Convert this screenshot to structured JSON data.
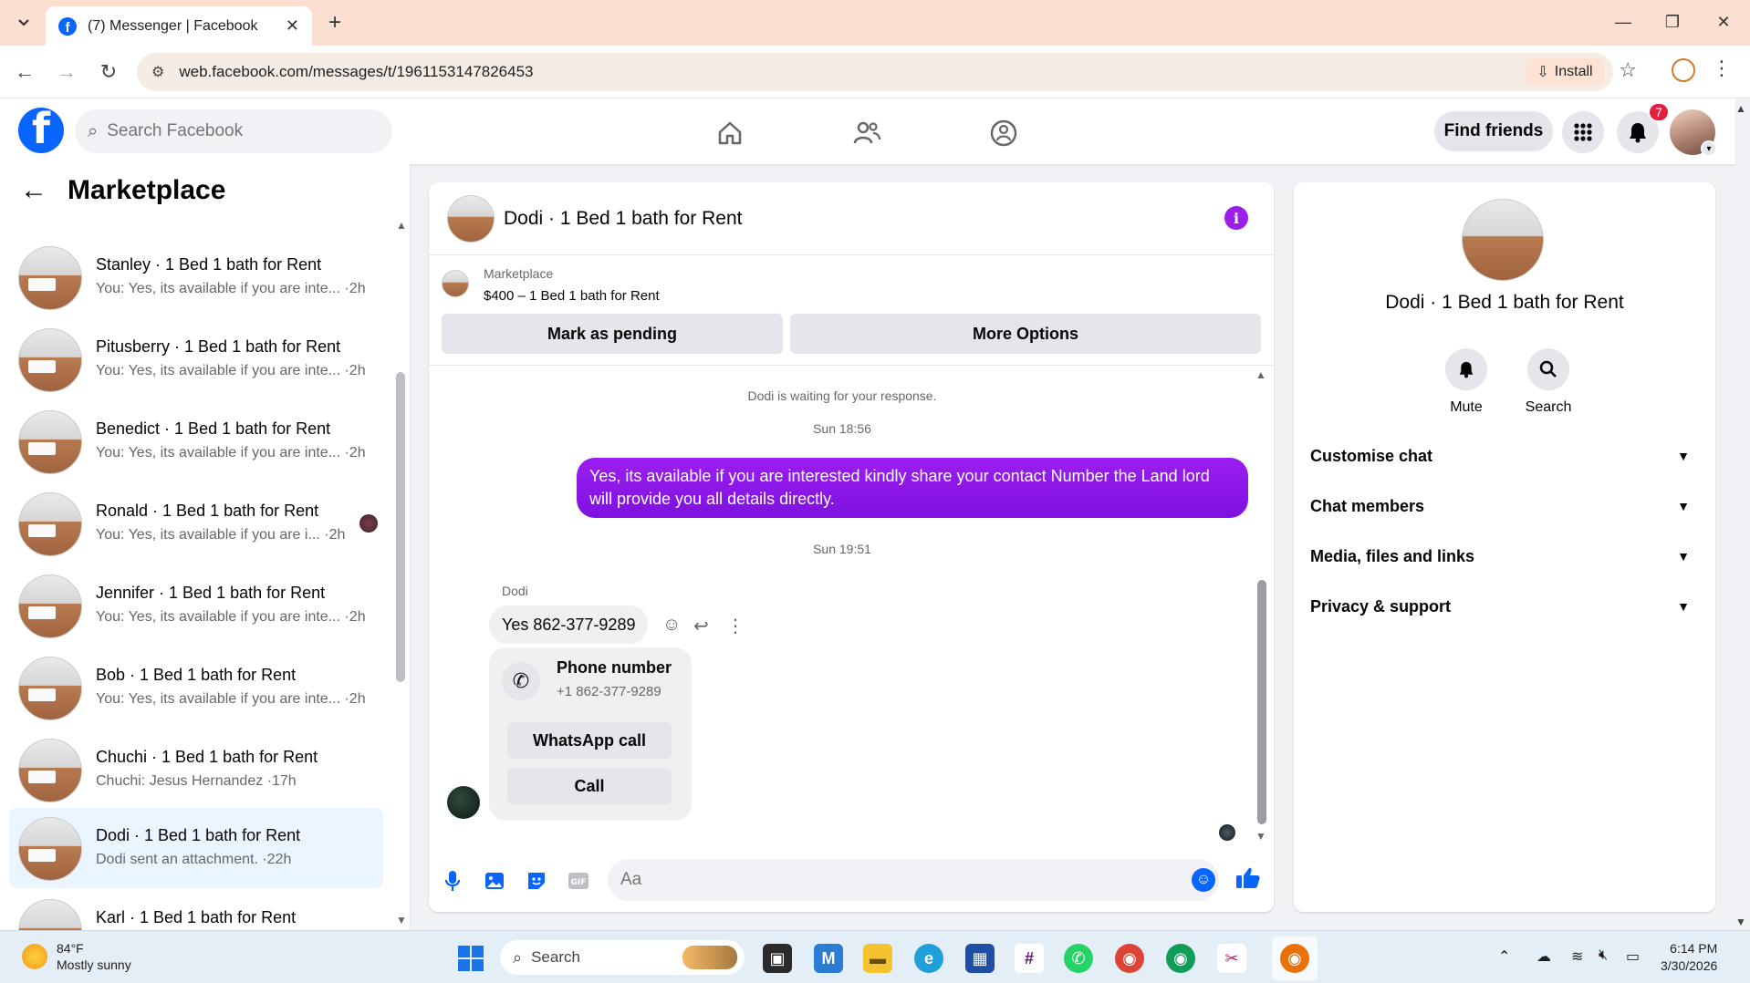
{
  "browser": {
    "tab_title": "(7) Messenger | Facebook",
    "url": "web.facebook.com/messages/t/1961153147826453",
    "install_label": "Install"
  },
  "header": {
    "search_placeholder": "Search Facebook",
    "find_friends_label": "Find friends",
    "notification_count": "7"
  },
  "sidebar": {
    "title": "Marketplace",
    "conversations": [
      {
        "name": "Stanley · 1 Bed 1 bath for Rent",
        "snippet": "You: Yes, its available if you are inte... ·2h"
      },
      {
        "name": "Pitusberry · 1 Bed 1 bath for Rent",
        "snippet": "You: Yes, its available if you are inte... ·2h"
      },
      {
        "name": "Benedict · 1 Bed 1 bath for Rent",
        "snippet": "You: Yes, its available if you are inte... ·2h"
      },
      {
        "name": "Ronald · 1 Bed 1 bath for Rent",
        "snippet": "You: Yes, its available if you are i... ·2h"
      },
      {
        "name": "Jennifer · 1 Bed 1 bath for Rent",
        "snippet": "You: Yes, its available if you are inte... ·2h"
      },
      {
        "name": "Bob · 1 Bed 1 bath for Rent",
        "snippet": "You: Yes, its available if you are inte... ·2h"
      },
      {
        "name": "Chuchi · 1 Bed 1 bath for Rent",
        "snippet": "Chuchi: Jesus Hernandez ·17h"
      },
      {
        "name": "Dodi · 1 Bed 1 bath for Rent",
        "snippet": "Dodi sent an attachment. ·22h"
      },
      {
        "name": "Karl · 1 Bed 1 bath for Rent",
        "snippet": ""
      }
    ]
  },
  "chat": {
    "title": "Dodi · 1 Bed 1 bath for Rent",
    "marketplace_label": "Marketplace",
    "listing": "$400 – 1 Bed 1 bath for Rent",
    "mark_pending_label": "Mark as pending",
    "more_options_label": "More Options",
    "waiting_notice": "Dodi is waiting for your response.",
    "time_1": "Sun 18:56",
    "outgoing_message": "Yes, its available if you are interested kindly share your contact Number the Land lord will provide you all details directly.",
    "time_2": "Sun 19:51",
    "sender_name": "Dodi",
    "incoming_message": "Yes 862-377-9289",
    "phone_card": {
      "title": "Phone number",
      "number": "+1 862-377-9289",
      "whatsapp_label": "WhatsApp call",
      "call_label": "Call"
    },
    "composer_placeholder": "Aa"
  },
  "info_panel": {
    "name": "Dodi · 1 Bed 1 bath for Rent",
    "mute_label": "Mute",
    "search_label": "Search",
    "sections": [
      "Customise chat",
      "Chat members",
      "Media, files and links",
      "Privacy & support"
    ]
  },
  "taskbar": {
    "temperature": "84°F",
    "weather": "Mostly sunny",
    "search_label": "Search",
    "time": "6:14 PM",
    "date": "3/30/2026"
  },
  "colors": {
    "facebook_blue": "#0866ff",
    "message_purple": "#8a1be8",
    "notification_red": "#e41e3f"
  }
}
